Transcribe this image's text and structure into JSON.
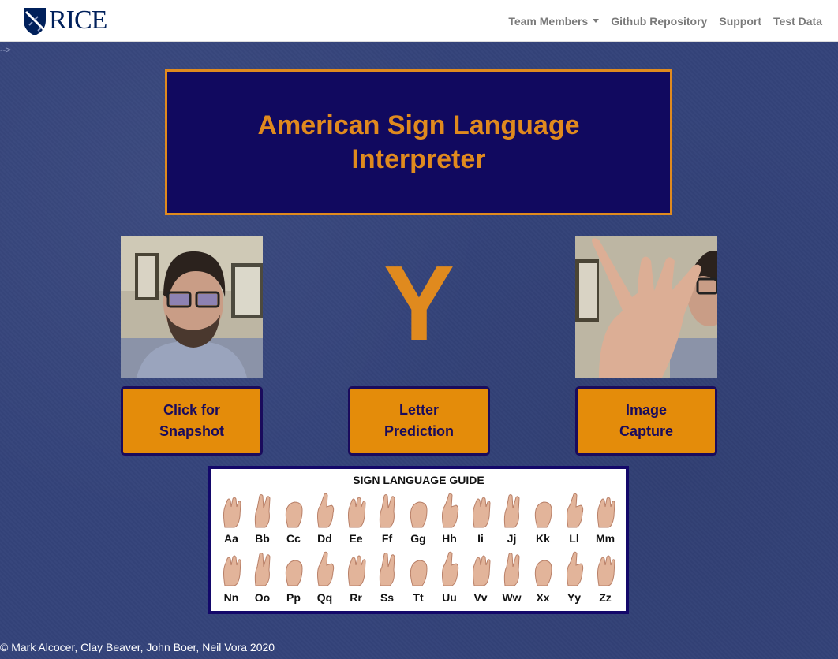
{
  "navbar": {
    "brand_text": "RICE",
    "items": [
      {
        "label": "Team Members"
      },
      {
        "label": "Github Repository"
      },
      {
        "label": "Support"
      },
      {
        "label": "Test Data"
      }
    ]
  },
  "stray_text": "-->",
  "header": {
    "title_line1": "American Sign Language",
    "title_line2": "Interpreter"
  },
  "prediction": {
    "letter": "Y"
  },
  "buttons": {
    "snapshot_label": "Click for Snapshot",
    "prediction_label": "Letter Prediction",
    "capture_label": "Image Capture"
  },
  "guide": {
    "title": "SIGN LANGUAGE GUIDE",
    "row1": [
      "Aa",
      "Bb",
      "Cc",
      "Dd",
      "Ee",
      "Ff",
      "Gg",
      "Hh",
      "Ii",
      "Jj",
      "Kk",
      "Ll",
      "Mm"
    ],
    "row2": [
      "Nn",
      "Oo",
      "Pp",
      "Qq",
      "Rr",
      "Ss",
      "Tt",
      "Uu",
      "Vv",
      "Ww",
      "Xx",
      "Yy",
      "Zz"
    ]
  },
  "footer": {
    "credits": "© Mark Alcocer, Clay Beaver, John Boer, Neil Vora 2020"
  },
  "colors": {
    "accent_orange": "#e08a1e",
    "button_orange": "#e48c0a",
    "title_box_bg": "#11095f",
    "page_bg": "#34437a"
  }
}
